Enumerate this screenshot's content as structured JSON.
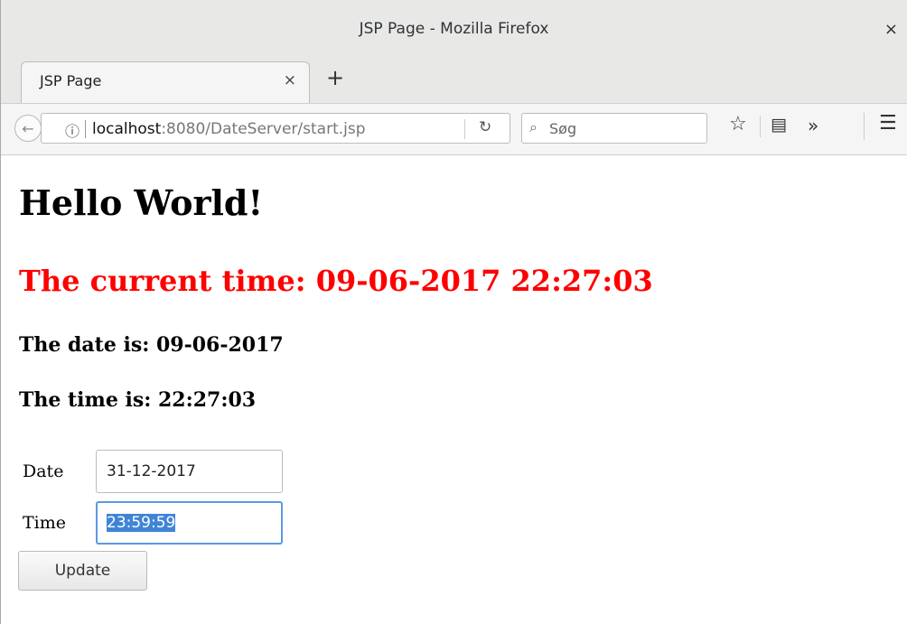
{
  "window": {
    "title": "JSP Page - Mozilla Firefox",
    "close_glyph": "×"
  },
  "tabs": {
    "active_label": "JSP Page",
    "close_glyph": "×",
    "new_tab_glyph": "+"
  },
  "nav": {
    "url_host": "localhost",
    "url_rest": ":8080/DateServer/start.jsp",
    "search_placeholder": "Søg",
    "icons": [
      "back-icon",
      "info-icon",
      "reload-icon",
      "search-icon",
      "star-icon",
      "reader-icon",
      "overflow-icon",
      "menu-icon"
    ]
  },
  "page": {
    "heading": "Hello World!",
    "current_time": "The current time: 09-06-2017 22:27:03",
    "date_line": "The date is: 09-06-2017",
    "time_line": "The time is: 22:27:03",
    "form": {
      "date_label": "Date",
      "date_value": "31-12-2017",
      "time_label": "Time",
      "time_value": "23:59:59",
      "submit_label": "Update"
    }
  },
  "colors": {
    "accent_red": "#ff0000",
    "focus_blue": "#5a9ae0",
    "selection": "#3f85d6"
  }
}
